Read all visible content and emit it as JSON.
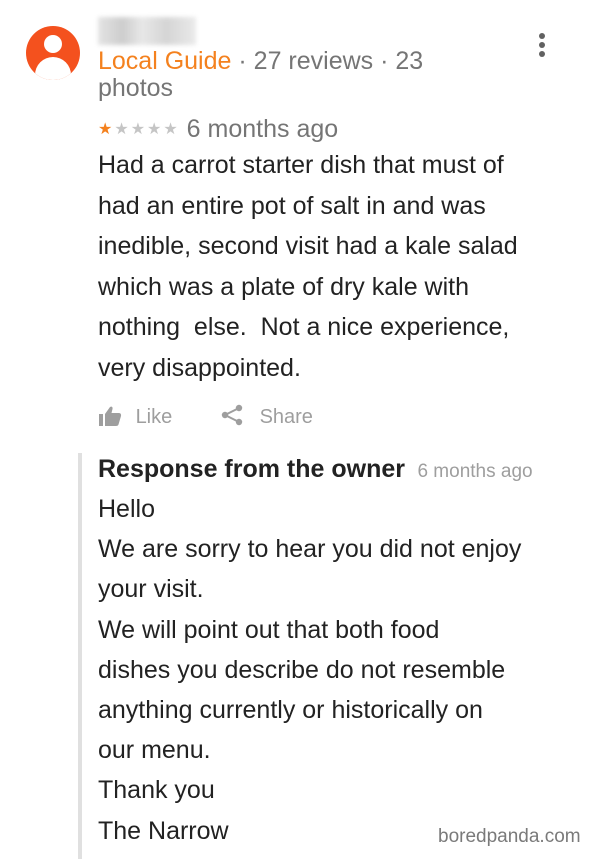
{
  "review": {
    "reviewer_badge": "Local Guide",
    "reviewer_stats": "· 27 reviews · 23 photos",
    "rating": 1,
    "rating_max": 5,
    "time": "6 months ago",
    "text": "Had a carrot starter dish that must of\nhad an entire pot of salt in and was\ninedible, second visit had a kale salad\nwhich was a plate of dry kale with\nnothing  else.  Not a nice experience,\nvery disappointed."
  },
  "actions": {
    "like_label": "Like",
    "share_label": "Share"
  },
  "owner_response": {
    "title": "Response from the owner",
    "time": "6 months ago",
    "text": "Hello\nWe are sorry to hear you did not enjoy\nyour visit.\nWe will point out that both food\ndishes you describe do not resemble\nanything currently or historically on\nour menu.\nThank you\nThe Narrow"
  },
  "watermark": "boredpanda.com",
  "colors": {
    "accent": "#f4811e",
    "avatar": "#f4511e",
    "muted": "#757575",
    "border": "#e0e0e0"
  },
  "icons": {
    "avatar": "person-icon",
    "more": "more-vert-icon",
    "like": "thumb-up-icon",
    "share": "share-icon"
  }
}
